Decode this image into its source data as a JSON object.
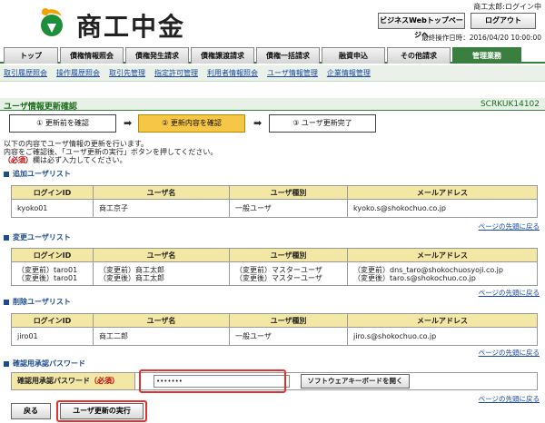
{
  "header": {
    "logo_text": "商工中金",
    "user_greet": "商工太郎:ログイン中",
    "top_button": "ビジネスWebトップページへ",
    "logout_button": "ログアウト",
    "last_op": "最終操作日時：2016/04/20 10:00:00"
  },
  "tabs": [
    "トップ",
    "債権情報照会",
    "債権発生請求",
    "債権譲渡請求",
    "債権一括請求",
    "融資申込",
    "その他請求",
    "管理業務"
  ],
  "subnav": [
    "取引履歴照会",
    "操作履歴照会",
    "取引先管理",
    "指定許可管理",
    "利用者情報照会",
    "ユーザ情報管理",
    "企業情報管理"
  ],
  "title": {
    "text": "ユーザ情報更新確認",
    "code": "SCRKUK14102"
  },
  "steps": [
    "① 更新前を確認",
    "② 更新内容を確認",
    "③ ユーザ更新完了"
  ],
  "arrow": "➡",
  "intro": {
    "line1": "以下の内容でユーザ情報の更新を行います。",
    "line2": "内容をご確認後、「ユーザ更新の実行」ボタンを押してください。",
    "req": "（必須）",
    "line3": "欄は必ず入力してください。"
  },
  "table_headers": [
    "ログインID",
    "ユーザ名",
    "ユーザ種別",
    "メールアドレス"
  ],
  "add_section": {
    "title": "追加ユーザリスト",
    "rows": [
      [
        "kyoko01",
        "商工京子",
        "一般ユーザ",
        "kyoko.s@shokochuo.co.jp"
      ]
    ]
  },
  "change_section": {
    "title": "変更ユーザリスト",
    "rows": [
      [
        "（変更前）taro01",
        "（変更前）商工太郎",
        "（変更前）マスターユーザ",
        "（変更前）dns_taro@shokochuosyoji.co.jp"
      ],
      [
        "（変更後）taro01",
        "（変更後）商工太郎",
        "（変更後）マスターユーザ",
        "（変更後）taro.s@shokochuo.co.jp"
      ]
    ]
  },
  "delete_section": {
    "title": "削除ユーザリスト",
    "rows": [
      [
        "jiro01",
        "商工二郎",
        "一般ユーザ",
        "jiro.s@shokochuo.co.jp"
      ]
    ]
  },
  "pagetop": "ページの先頭に戻る",
  "password": {
    "section_title": "確認用承認パスワード",
    "label": "確認用承認パスワード",
    "req": "（必須）",
    "value": "•••••••",
    "softkb": "ソフトウェアキーボードを開く"
  },
  "buttons": {
    "back": "戻る",
    "execute": "ユーザ更新の実行"
  },
  "colors": {
    "accent_green": "#3b7f40",
    "highlight_red": "#e53030",
    "step_current": "#f6c646",
    "header_yellow": "#f3e7a6"
  }
}
